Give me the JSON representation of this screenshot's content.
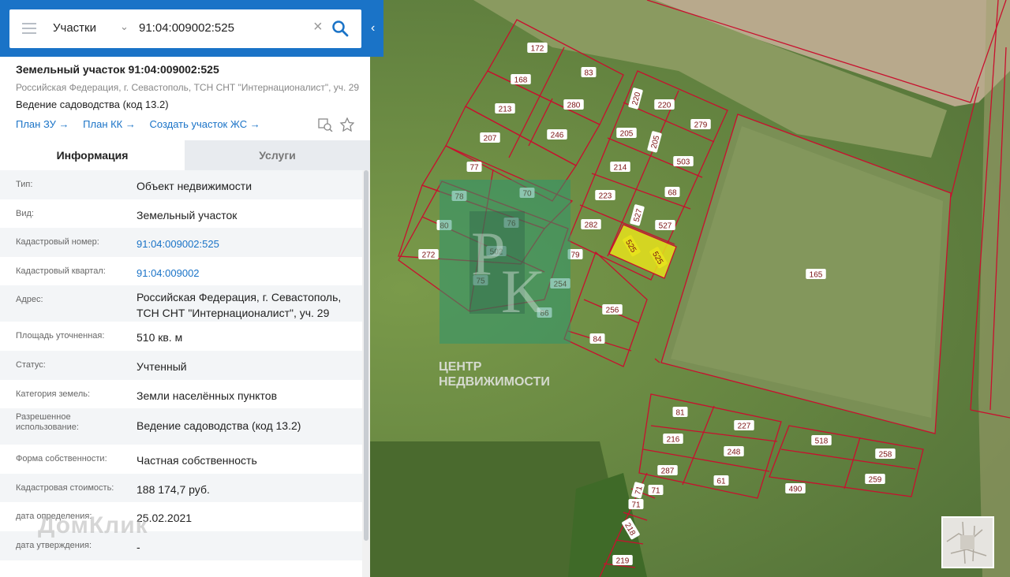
{
  "search": {
    "type_label": "Участки",
    "query": "91:04:009002:525"
  },
  "parcel": {
    "title": "Земельный участок 91:04:009002:525",
    "address_short": "Российская Федерация, г. Севастополь, ТСН СНТ \"Интернационалист\", уч. 29",
    "use": "Ведение садоводства (код 13.2)",
    "links": [
      "План ЗУ →",
      "План КК →",
      "Создать участок ЖС →"
    ]
  },
  "tabs": [
    "Информация",
    "Услуги"
  ],
  "info": [
    {
      "label": "Тип:",
      "value": "Объект недвижимости"
    },
    {
      "label": "Вид:",
      "value": "Земельный участок"
    },
    {
      "label": "Кадастровый номер:",
      "value": "91:04:009002:525",
      "link": true
    },
    {
      "label": "Кадастровый квартал:",
      "value": "91:04:009002",
      "link": true
    },
    {
      "label": "Адрес:",
      "value": "Российская Федерация, г. Севастополь,",
      "value2": "ТСН СНТ \"Интернационалист\", уч. 29"
    },
    {
      "label": "Площадь уточненная:",
      "value": "510 кв. м"
    },
    {
      "label": "Статус:",
      "value": "Учтенный"
    },
    {
      "label": "Категория земель:",
      "value": "Земли населённых пунктов"
    },
    {
      "label": "Разрешенное использование:",
      "value": "Ведение садоводства (код 13.2)"
    },
    {
      "label": "Форма собственности:",
      "value": "Частная собственность"
    },
    {
      "label": "Кадастровая стоимость:",
      "value": "188 174,7 руб."
    },
    {
      "label": "дата определения:",
      "value": "25.02.2021"
    },
    {
      "label": "дата утверждения:",
      "value": "-"
    }
  ],
  "watermark": "ДомКлик",
  "map_logo": {
    "line1": "ЦЕНТР",
    "line2": "НЕДВИЖИМОСТИ",
    "mark": "PK"
  },
  "colors": {
    "accent": "#1a73c7",
    "parcel_line": "#c8102e",
    "selected": "#e6e21c"
  },
  "parcel_labels": [
    "172",
    "83",
    "168",
    "213",
    "280",
    "207",
    "246",
    "220",
    "220",
    "279",
    "205",
    "205",
    "503",
    "214",
    "77",
    "78",
    "70",
    "68",
    "223",
    "527",
    "80",
    "76",
    "282",
    "527",
    "272",
    "502",
    "525",
    "525",
    "79",
    "75",
    "254",
    "165",
    "256",
    "86",
    "84",
    "81",
    "227",
    "216",
    "248",
    "518",
    "258",
    "287",
    "61",
    "259",
    "490",
    "71",
    "71",
    "71",
    "218",
    "219"
  ]
}
